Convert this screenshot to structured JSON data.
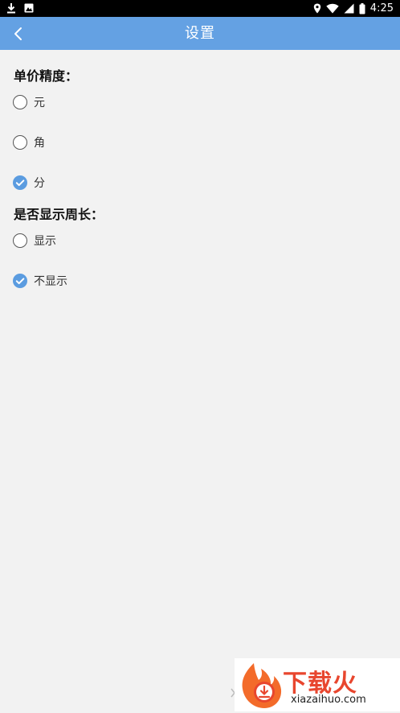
{
  "status_bar": {
    "time": "4:25",
    "left_icons": [
      "download-icon",
      "photo-icon"
    ],
    "right_icons": [
      "location-icon",
      "wifi-icon",
      "signal-icon",
      "battery-icon"
    ]
  },
  "app_bar": {
    "title": "设置",
    "back_icon": "chevron-left-icon",
    "background": "#64a1e3"
  },
  "precision": {
    "title": "单价精度：",
    "options": [
      {
        "label": "元",
        "checked": false
      },
      {
        "label": "角",
        "checked": false
      },
      {
        "label": "分",
        "checked": true
      }
    ]
  },
  "perimeter": {
    "title": "是否显示周长：",
    "options": [
      {
        "label": "显示",
        "checked": false
      },
      {
        "label": "不显示",
        "checked": true
      }
    ]
  },
  "watermark": {
    "brand": "下载火",
    "domain": "xiazaihuo.com"
  },
  "colors": {
    "accent": "#64a1e3",
    "check": "#5b9ce0",
    "page_bg": "#f2f2f2"
  }
}
